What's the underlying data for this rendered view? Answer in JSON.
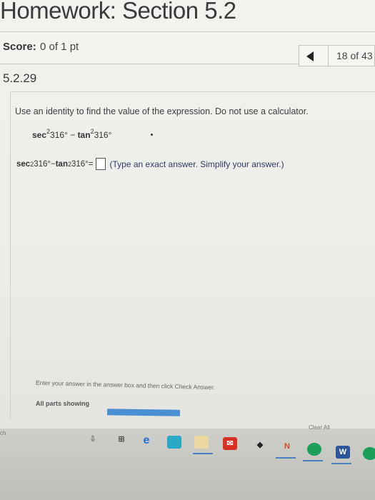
{
  "header": {
    "title": "Homework: Section 5.2"
  },
  "score": {
    "label": "Score:",
    "value": "0 of 1 pt"
  },
  "navigation": {
    "counter": "18 of 43"
  },
  "problem": {
    "id": "5.2.29",
    "instruction": "Use an identity to find the value of the expression. Do not use a calculator.",
    "expression": {
      "sec": "sec",
      "sec_angle": "316°",
      "minus": " − ",
      "tan": "tan",
      "tan_angle": "316°",
      "exp": "2"
    },
    "answer": {
      "equals": " =",
      "hint": "(Type an exact answer. Simplify your answer.)"
    }
  },
  "footer": {
    "message": "Enter your answer in the answer box and then click Check Answer.",
    "parts_label": "All parts showing",
    "progress_fraction": 1.0,
    "clear_all": "Clear All"
  },
  "taskbar": {
    "search_text": "ch",
    "colors": {
      "edge": "#1f6fd1",
      "mail": "#d93025",
      "office": "#d24726",
      "word": "#2b579a",
      "chrome": "#1a9f5a"
    }
  }
}
